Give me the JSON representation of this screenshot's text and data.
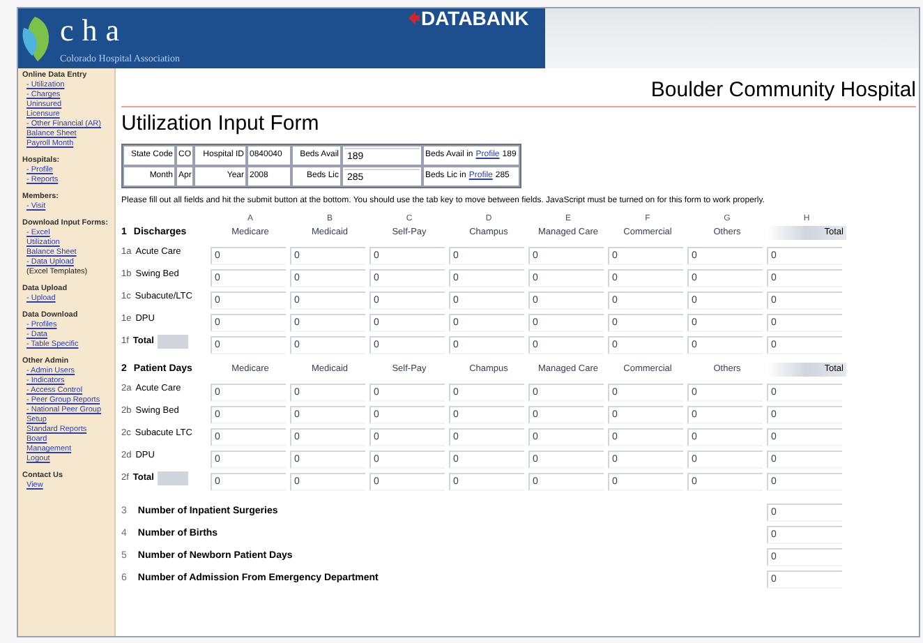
{
  "header": {
    "logo_text": "cha",
    "logo_subtitle": "Colorado Hospital Association",
    "banner_title": "DATABANK"
  },
  "hospital_name": "Boulder Community Hospital",
  "sidebar": [
    {
      "title": "Online Data Entry",
      "items": [
        {
          "label": "- Utilization",
          "kind": "link"
        },
        {
          "label": "- Charges",
          "kind": "link"
        },
        {
          "label": "Uninsured",
          "kind": "link"
        },
        {
          "label": "Licensure",
          "kind": "link"
        },
        {
          "label": "- Other Financial (AR)",
          "kind": "link"
        },
        {
          "label": "Balance Sheet",
          "kind": "link"
        },
        {
          "label": "Payroll Month",
          "kind": "link"
        }
      ]
    },
    {
      "title": "Hospitals:",
      "items": [
        {
          "label": "- Profile",
          "kind": "link"
        },
        {
          "label": "- Reports",
          "kind": "link"
        }
      ]
    },
    {
      "title": "Members:",
      "items": [
        {
          "label": "- Visit",
          "kind": "link"
        }
      ]
    },
    {
      "title": "Download Input Forms:",
      "items": [
        {
          "label": "- Excel",
          "kind": "link"
        },
        {
          "label": "Utilization",
          "kind": "link"
        },
        {
          "label": "Balance Sheet",
          "kind": "link"
        },
        {
          "label": "- Data Upload",
          "kind": "link"
        },
        {
          "label": "(Excel Templates)",
          "kind": "note"
        }
      ]
    },
    {
      "title": "Data Upload",
      "items": [
        {
          "label": "- Upload",
          "kind": "link"
        }
      ]
    },
    {
      "title": "Data Download",
      "items": [
        {
          "label": "- Profiles",
          "kind": "link"
        },
        {
          "label": "- Data",
          "kind": "link"
        },
        {
          "label": "- Table Specific",
          "kind": "link"
        }
      ]
    },
    {
      "title": "Other Admin",
      "items": [
        {
          "label": "- Admin Users",
          "kind": "link"
        },
        {
          "label": "- Indicators",
          "kind": "link"
        },
        {
          "label": "- Access Control",
          "kind": "link"
        },
        {
          "label": "- Peer Group Reports",
          "kind": "link"
        },
        {
          "label": "- National Peer Group Setup",
          "kind": "link"
        },
        {
          "label": "Standard Reports",
          "kind": "link"
        },
        {
          "label": "Board",
          "kind": "link"
        },
        {
          "label": "Management",
          "kind": "link"
        },
        {
          "label": "Logout",
          "kind": "link"
        }
      ]
    },
    {
      "title": "Contact Us",
      "items": [
        {
          "label": "View",
          "kind": "link"
        }
      ]
    }
  ],
  "form_title": "Utilization Input Form",
  "info_table": [
    [
      {
        "kind": "label",
        "text": "State Code"
      },
      {
        "kind": "value",
        "text": "CO"
      },
      {
        "kind": "label",
        "text": "Hospital ID"
      },
      {
        "kind": "value",
        "text": "0840040"
      },
      {
        "kind": "label",
        "text": "Beds Avail"
      },
      {
        "kind": "input",
        "text": "189"
      },
      {
        "kind": "profile",
        "prefix": "Beds Avail in",
        "link": "Profile",
        "text": "189"
      }
    ],
    [
      {
        "kind": "label",
        "text": "Month"
      },
      {
        "kind": "value",
        "text": "Apr"
      },
      {
        "kind": "label",
        "text": "Year"
      },
      {
        "kind": "value",
        "text": "2008"
      },
      {
        "kind": "label",
        "text": "Beds Lic"
      },
      {
        "kind": "input",
        "text": "285"
      },
      {
        "kind": "profile",
        "prefix": "Beds Lic in",
        "link": "Profile",
        "text": "285"
      }
    ]
  ],
  "instructions": "Please fill out all fields and hit the submit button at the bottom. You should use the tab key to move between fields. JavaScript must be turned on for this form to work properly.",
  "sections": [
    {
      "number": "1",
      "title": "Discharges",
      "letters": [
        "A",
        "B",
        "C",
        "D",
        "E",
        "F",
        "G",
        "H"
      ],
      "columns": [
        "Medicare",
        "Medicaid",
        "Self-Pay",
        "Champus",
        "Managed Care",
        "Commercial",
        "Others",
        "Total"
      ],
      "rows": [
        {
          "code": "1a",
          "label": "Acute Care",
          "kind": "data",
          "values": [
            "0",
            "0",
            "0",
            "0",
            "0",
            "0",
            "0",
            "0"
          ]
        },
        {
          "code": "1b",
          "label": "Swing Bed",
          "kind": "data",
          "values": [
            "0",
            "0",
            "0",
            "0",
            "0",
            "0",
            "0",
            "0"
          ]
        },
        {
          "code": "1c",
          "label": "Subacute/LTC",
          "kind": "data",
          "values": [
            "0",
            "0",
            "0",
            "0",
            "0",
            "0",
            "0",
            "0"
          ]
        },
        {
          "code": "1e",
          "label": "DPU",
          "kind": "data",
          "values": [
            "0",
            "0",
            "0",
            "0",
            "0",
            "0",
            "0",
            "0"
          ]
        },
        {
          "code": "1f",
          "label": "Total",
          "kind": "total",
          "values": [
            "0",
            "0",
            "0",
            "0",
            "0",
            "0",
            "0",
            "0"
          ]
        }
      ]
    },
    {
      "number": "2",
      "title": "Patient Days",
      "columns": [
        "Medicare",
        "Medicaid",
        "Self-Pay",
        "Champus",
        "Managed Care",
        "Commercial",
        "Others",
        "Total"
      ],
      "rows": [
        {
          "code": "2a",
          "label": "Acute Care",
          "kind": "data",
          "values": [
            "0",
            "0",
            "0",
            "0",
            "0",
            "0",
            "0",
            "0"
          ]
        },
        {
          "code": "2b",
          "label": "Swing Bed",
          "kind": "data",
          "values": [
            "0",
            "0",
            "0",
            "0",
            "0",
            "0",
            "0",
            "0"
          ]
        },
        {
          "code": "2c",
          "label": "Subacute LTC",
          "kind": "data",
          "values": [
            "0",
            "0",
            "0",
            "0",
            "0",
            "0",
            "0",
            "0"
          ]
        },
        {
          "code": "2d",
          "label": "DPU",
          "kind": "data",
          "values": [
            "0",
            "0",
            "0",
            "0",
            "0",
            "0",
            "0",
            "0"
          ]
        },
        {
          "code": "2f",
          "label": "Total",
          "kind": "total",
          "values": [
            "0",
            "0",
            "0",
            "0",
            "0",
            "0",
            "0",
            "0"
          ]
        }
      ]
    }
  ],
  "questions": [
    {
      "number": "3",
      "label": "Number of Inpatient Surgeries",
      "value": "0"
    },
    {
      "number": "4",
      "label": "Number of Births",
      "value": "0"
    },
    {
      "number": "5",
      "label": "Number of Newborn Patient Days",
      "value": "0"
    },
    {
      "number": "6",
      "label": "Number of Admission From Emergency Department",
      "value": "0"
    }
  ]
}
